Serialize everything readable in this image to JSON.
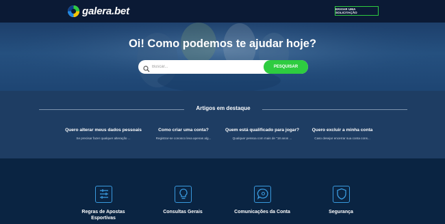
{
  "header": {
    "logo_text": "galera.bet",
    "cta_label": "ENVIAR UMA SOLICITAÇÃO"
  },
  "hero": {
    "title": "Oi! Como podemos te ajudar hoje?",
    "search_placeholder": "Buscar...",
    "search_button": "PESQUISAR"
  },
  "featured": {
    "title": "Artigos em destaque",
    "articles": [
      {
        "title": "Quero alterar meus dados pessoais",
        "snippet": "Se precisar fazer qualquer alteração ..."
      },
      {
        "title": "Como criar uma conta?",
        "snippet": "Registrar-se conosco leva apenas alg..."
      },
      {
        "title": "Quem está qualificado para jogar?",
        "snippet": "Qualquer pessoa com mais de \"18 anos ..."
      },
      {
        "title": "Quero excluir a minha conta",
        "snippet": "Caso desejar encerrar sua conta cons..."
      }
    ]
  },
  "categories": [
    {
      "label": "Regras de Apostas Esportivas",
      "icon": "sliders-icon"
    },
    {
      "label": "Consultas Gerais",
      "icon": "lightbulb-icon"
    },
    {
      "label": "Comunicações da Conta",
      "icon": "chat-bubble-icon"
    },
    {
      "label": "Segurança",
      "icon": "shield-icon"
    }
  ],
  "colors": {
    "accent_green": "#2ecc40",
    "icon_blue": "#3a9be0",
    "header_bg": "#0b1a35"
  }
}
